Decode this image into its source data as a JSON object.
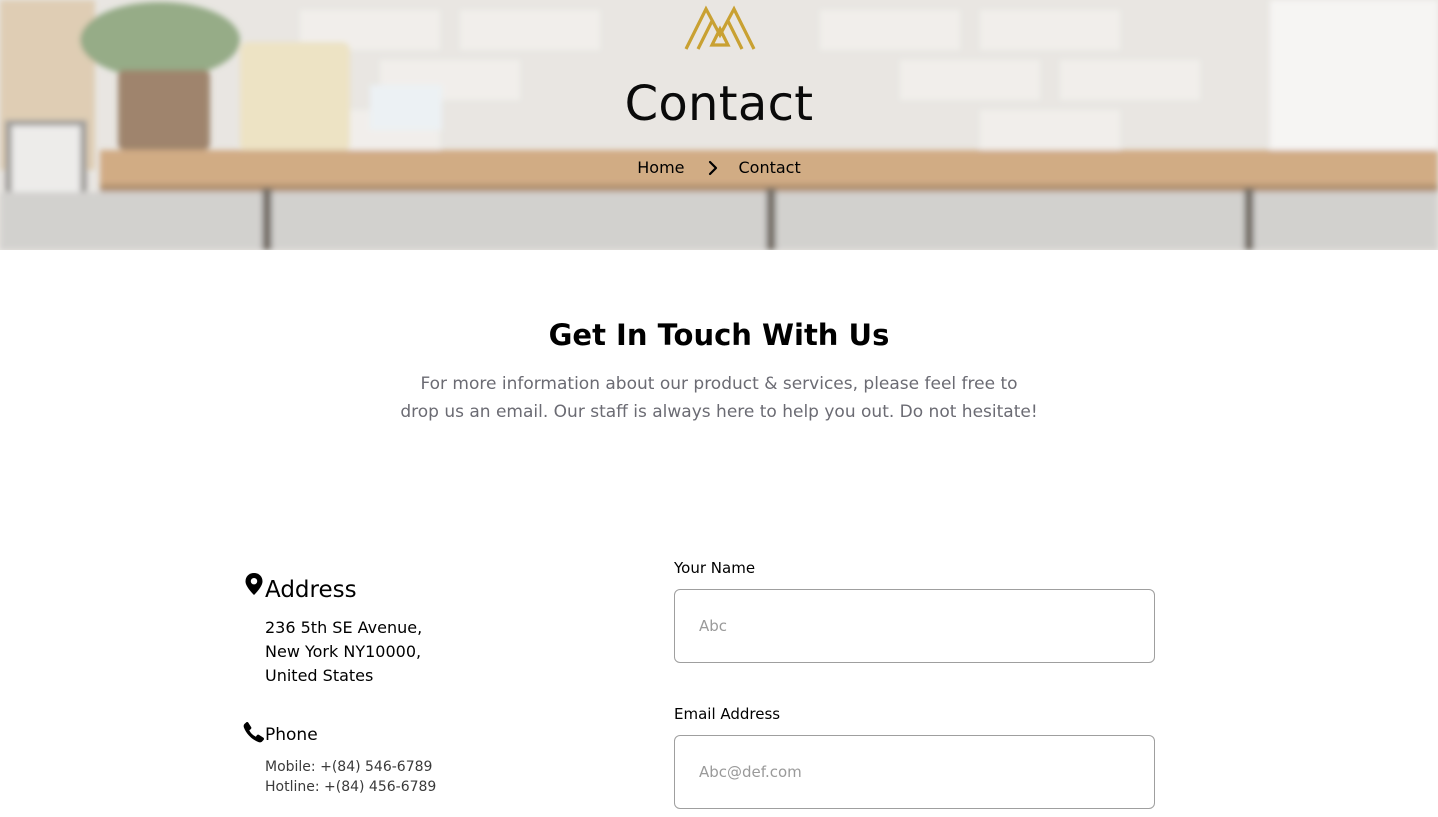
{
  "hero": {
    "title": "Contact",
    "breadcrumb": {
      "home": "Home",
      "current": "Contact"
    }
  },
  "intro": {
    "title": "Get In Touch With Us",
    "description": "For more information about our product & services, please feel free to drop us an email. Our staff is always here to help you out. Do not hesitate!"
  },
  "contact_info": {
    "address": {
      "title": "Address",
      "icon": "map-pin-icon",
      "lines": [
        "236 5th SE Avenue,",
        "New York NY10000,",
        "United States"
      ]
    },
    "phone": {
      "title": "Phone",
      "icon": "phone-icon",
      "lines": [
        "Mobile: +(84) 546-6789",
        "Hotline: +(84) 456-6789"
      ]
    }
  },
  "form": {
    "name": {
      "label": "Your Name",
      "placeholder": "Abc",
      "value": ""
    },
    "email": {
      "label": "Email Address",
      "placeholder": "Abc@def.com",
      "value": ""
    }
  },
  "colors": {
    "brand_gold": "#c9a132",
    "muted_text": "#6b6b73",
    "input_border": "#9f9f9f"
  }
}
